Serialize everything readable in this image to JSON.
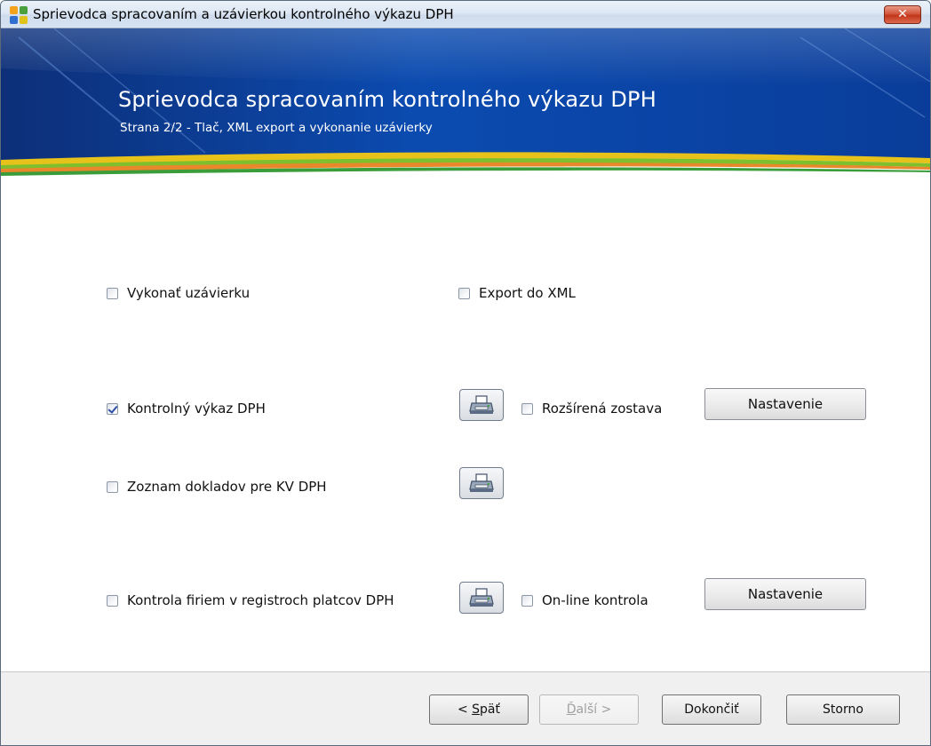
{
  "window": {
    "title": "Sprievodca spracovaním a uzávierkou kontrolného výkazu DPH",
    "close_label": "✕"
  },
  "banner": {
    "title": "Sprievodca spracovaním kontrolného výkazu DPH",
    "subtitle": "Strana 2/2 - Tlač, XML export a vykonanie uzávierky"
  },
  "options": {
    "vykonat_uzavierku": {
      "label": "Vykonať uzávierku",
      "checked": false
    },
    "export_xml": {
      "label": "Export do XML",
      "checked": false
    },
    "kontrolny_vykaz": {
      "label": "Kontrolný výkaz DPH",
      "checked": true
    },
    "rozsirena_zostava": {
      "label": "Rozšírená zostava",
      "checked": false
    },
    "zoznam_dokladov": {
      "label": "Zoznam dokladov pre KV DPH",
      "checked": false
    },
    "kontrola_firiem": {
      "label": "Kontrola firiem v registroch platcov DPH",
      "checked": false
    },
    "online_kontrola": {
      "label": "On-line kontrola",
      "checked": false
    }
  },
  "buttons": {
    "nastavenie_1": "Nastavenie",
    "nastavenie_2": "Nastavenie"
  },
  "footer": {
    "back": {
      "prefix": "< ",
      "accel": "S",
      "rest": "päť"
    },
    "next": {
      "accel": "Ď",
      "rest": "alší >"
    },
    "finish": "Dokončiť",
    "cancel": "Storno"
  },
  "icons": {
    "app": "wizard-app-icon",
    "print": "printer-icon"
  },
  "colors": {
    "banner_blue": "#0a3f9c",
    "close_red": "#c8401f",
    "checkmark": "#2c4fa8"
  }
}
